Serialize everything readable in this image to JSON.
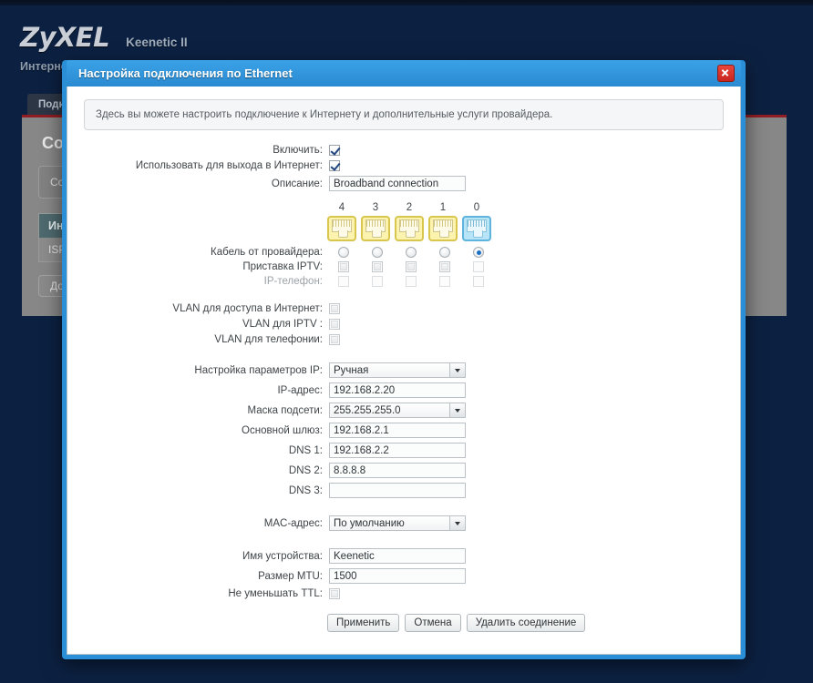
{
  "header": {
    "brand": "ZyXEL",
    "product": "Keenetic II",
    "breadcrumb": "Интернет"
  },
  "background_page": {
    "tab_label": "Подключения",
    "title": "Соединения",
    "info_text": "Соединения, необходимые для настройки, указаны ниже в списке подключений сети",
    "section_header": "Интернет",
    "section_row": "ISP",
    "add_button": "Добавить соединение"
  },
  "dialog": {
    "title": "Настройка подключения по Ethernet",
    "close_icon": "close-icon",
    "info_text": "Здесь вы можете настроить подключение к Интернету и дополнительные услуги провайдера.",
    "fields": {
      "enable_label": "Включить:",
      "enable_checked": true,
      "use_for_internet_label": "Использовать для выхода в Интернет:",
      "use_for_internet_checked": true,
      "description_label": "Описание:",
      "description_value": "Broadband connection"
    },
    "ports": {
      "numbers": [
        "4",
        "3",
        "2",
        "1",
        "0"
      ],
      "kinds": [
        "lan",
        "lan",
        "lan",
        "lan",
        "wan"
      ],
      "isp_cable_label": "Кабель от провайдера:",
      "isp_cable_selected_index": 4,
      "iptv_label": "Приставка IPTV:",
      "iptv_states": [
        "empty",
        "empty",
        "empty",
        "empty",
        "disabled"
      ],
      "ipphone_label": "IP-телефон:",
      "ipphone_states": [
        "disabled",
        "disabled",
        "disabled",
        "disabled",
        "disabled"
      ]
    },
    "vlan": {
      "internet_label": "VLAN для доступа в Интернет:",
      "internet_checked": false,
      "iptv_label": "VLAN для IPTV :",
      "iptv_checked": false,
      "telephony_label": "VLAN для телефонии:",
      "telephony_checked": false
    },
    "ip_settings": {
      "config_label": "Настройка параметров IP:",
      "config_value": "Ручная",
      "ip_label": "IP-адрес:",
      "ip_value": "192.168.2.20",
      "mask_label": "Маска подсети:",
      "mask_value": "255.255.255.0",
      "gateway_label": "Основной шлюз:",
      "gateway_value": "192.168.2.1",
      "dns1_label": "DNS 1:",
      "dns1_value": "192.168.2.2",
      "dns2_label": "DNS 2:",
      "dns2_value": "8.8.8.8",
      "dns3_label": "DNS 3:",
      "dns3_value": ""
    },
    "mac": {
      "label": "MAC-адрес:",
      "value": "По умолчанию"
    },
    "device": {
      "name_label": "Имя устройства:",
      "name_value": "Keenetic",
      "mtu_label": "Размер MTU:",
      "mtu_value": "1500",
      "ttl_label": "Не уменьшать TTL:",
      "ttl_checked": false
    },
    "buttons": {
      "apply": "Применить",
      "cancel": "Отмена",
      "delete": "Удалить соединение"
    }
  },
  "colors": {
    "dialog_border": "#2b8fd8",
    "title_bar": "#3ba2e6",
    "close_red": "#c7251d",
    "lan_port": "#fbf3ae",
    "wan_port": "#b8e4f7",
    "page_bg": "#0c2142"
  }
}
